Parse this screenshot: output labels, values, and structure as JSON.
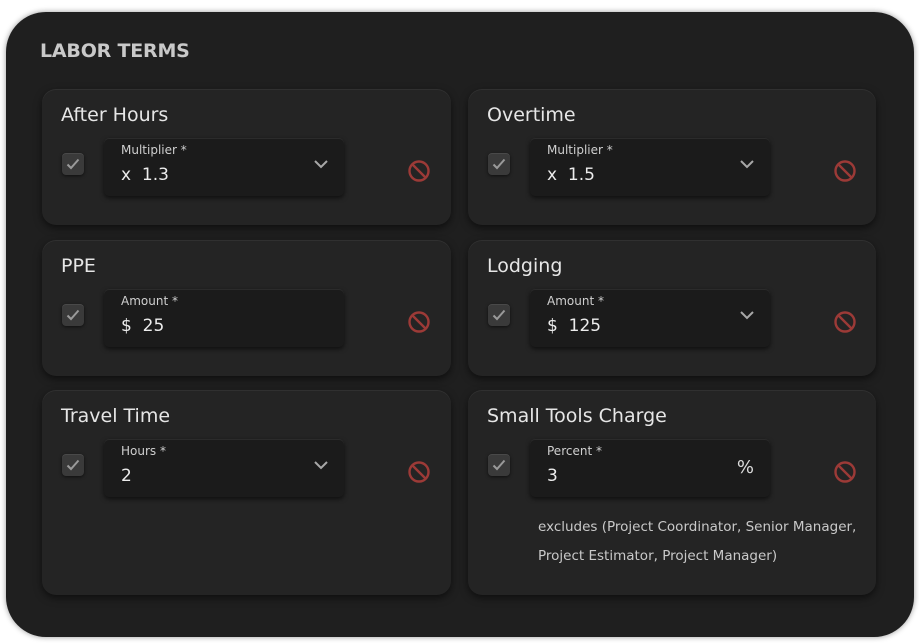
{
  "panel": {
    "title": "LABOR TERMS"
  },
  "cards": [
    {
      "title": "After Hours",
      "field_label": "Multiplier *",
      "prefix": "x",
      "value": "1.3",
      "control": "dropdown",
      "checked": true
    },
    {
      "title": "Overtime",
      "field_label": "Multiplier *",
      "prefix": "x",
      "value": "1.5",
      "control": "dropdown",
      "checked": true
    },
    {
      "title": "PPE",
      "field_label": "Amount *",
      "prefix": "$",
      "value": "25",
      "control": "text",
      "checked": true
    },
    {
      "title": "Lodging",
      "field_label": "Amount *",
      "prefix": "$",
      "value": "125",
      "control": "dropdown",
      "checked": true
    },
    {
      "title": "Travel Time",
      "field_label": "Hours *",
      "prefix": "",
      "value": "2",
      "control": "dropdown",
      "checked": true
    },
    {
      "title": "Small Tools Charge",
      "field_label": "Percent *",
      "prefix": "",
      "value": "3",
      "suffix": "%",
      "control": "percent",
      "checked": true,
      "note": "excludes (Project Coordinator, Senior Manager, Project Estimator, Project Manager)"
    }
  ],
  "icons": {
    "checkbox": "check-icon",
    "dropdown": "chevron-down-icon",
    "remove": "no-entry-icon"
  },
  "colors": {
    "panel_bg": "#1f1f1f",
    "card_bg": "#242424",
    "field_bg": "#1b1b1b",
    "remove_icon": "#9c3a37"
  }
}
